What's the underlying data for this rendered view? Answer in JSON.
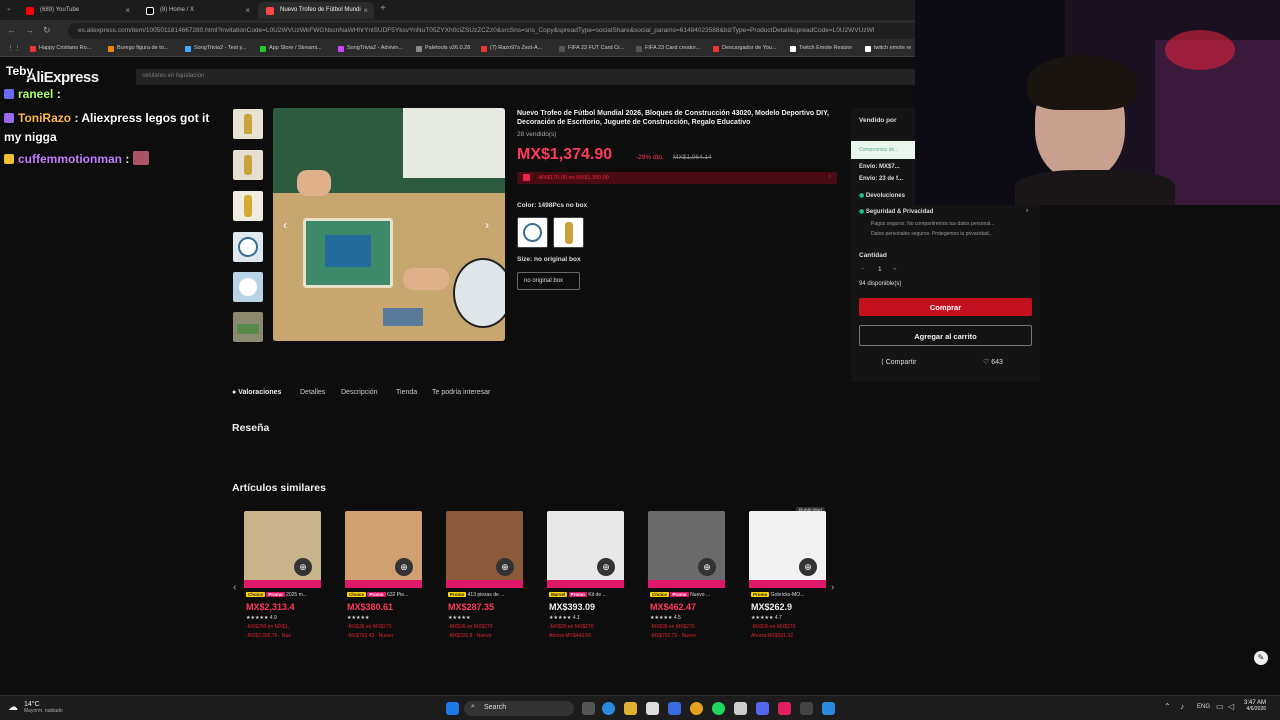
{
  "browser": {
    "tabs": [
      {
        "label": "(689) YouTube",
        "color": "#ff0000"
      },
      {
        "label": "(8) Home / X",
        "color": "#ffffff"
      },
      {
        "label": "Nuevo Trofeo de Fútbol Mundi",
        "color": "#ff4747"
      }
    ],
    "url": "es.aliexpress.com/item/1005011814667280.html?invitationCode=L0U2WVUzWkFWGNscnNaWHhrYnlSUDF5YksvYnNuT05ZYXh0clZSUzZCZz0&srcSns=sns_Copy&spreadType=socialShare&social_params=61484023588&bizType=ProductDetail&spreadCode=L0U2WVUzWl",
    "bookmarks": [
      "Happy Cristiano Ro...",
      "Burego figura de to...",
      "SongTrivia2 - Test y...",
      "App Store / Streami...",
      "SongTrivia2 - Advivin...",
      "Paletools v26.0.28",
      "(7) Razo97s Zest-A...",
      "FIFA 23 FUT Card Cr...",
      "FIFA 23 Card creator...",
      "Descargador de You...",
      "Twitch Emote Resizer",
      "twitch emote re"
    ]
  },
  "page": {
    "logo": "AliExpress",
    "search_placeholder": "celulares en liquidacion"
  },
  "chat": [
    {
      "user": "Teby",
      "text": ""
    },
    {
      "user": "raneel",
      "text": ":"
    },
    {
      "user": "ToniRazo",
      "text": ": Aliexpress legos got it my nigga"
    },
    {
      "user": "cuffemmotionman",
      "text": ":"
    }
  ],
  "product": {
    "title": "Nuevo Trofeo de Fútbol Mundial 2026, Bloques de Construcción 43020, Modelo Deportivo DIY, Decoración de Escritorio, Juguete de Construcción, Regalo Educativo",
    "sold": "28 vendido(s)",
    "price": "MX$1,374.90",
    "discount": "-29% dto.",
    "old_price": "MX$1,964.14",
    "coupon": "-MX$170.00 en MX$1,350.00",
    "color_label": "Color: 1498Pcs no box",
    "size_label": "Size: no original box",
    "size_option": "no original box"
  },
  "panel": {
    "sold_by": "Vendido por",
    "guarantee": "Compromiso de...",
    "shipping1": "Envío: MX$7...",
    "shipping2": "Envío: 23 de f...",
    "returns": "Devoluciones",
    "security": "Seguridad & Privacidad",
    "security_l1": "Pagos seguros: No compartiremos tus datos personal...",
    "security_l2": "Datos personales seguros: Protegemos tu privacidad...",
    "qty_label": "Cantidad",
    "qty_value": "1",
    "available": "94 disponible(s)",
    "buy": "Comprar",
    "cart": "Agregar al carrito",
    "share": "Compartir",
    "likes": "643"
  },
  "tabs": [
    "Valoraciones",
    "Detalles",
    "Descripción",
    "Tienda",
    "Te podría interesar"
  ],
  "sections": {
    "review": "Reseña",
    "similar": "Artículos similares"
  },
  "similar": [
    {
      "tag1": "Choice",
      "tag2": "Promo",
      "title": "2025 m...",
      "price": "MX$2,313.4",
      "rating": "4.9",
      "l1": "-MX$250 en MX$1,",
      "l2": "-MX$2,655.76 · Nue",
      "img": "#c8b48a",
      "price_red": true
    },
    {
      "tag1": "Choice",
      "tag2": "Promo",
      "title": "632 Pie...",
      "price": "MX$380.61",
      "rating": "",
      "l1": "-MX$36 en MX$270",
      "l2": "-MX$793.43 · Nuevo",
      "img": "#d0a070",
      "price_red": true
    },
    {
      "tag1": "Promo",
      "tag2": "",
      "title": "413 piezas de ...",
      "price": "MX$287.35",
      "rating": "",
      "l1": "-MX$36 en MX$270",
      "l2": "-MX$331.8 · Nuevo",
      "img": "#8a5a3a",
      "price_red": true
    },
    {
      "tag1": "Marvel",
      "tag2": "Promo",
      "title": "Kit de ...",
      "price": "MX$393.09",
      "rating": "4.1",
      "l1": "-MX$36 en MX$270",
      "l2": "Ahorra MX$443.66",
      "img": "#e8e8e8",
      "price_red": false
    },
    {
      "tag1": "Choice",
      "tag2": "Promo",
      "title": "Nuevo ...",
      "price": "MX$462.47",
      "rating": "4.5",
      "l1": "-MX$36 en MX$270",
      "l2": "-MX$792.73 · Nuevo",
      "img": "#6a6a6a",
      "price_red": true
    },
    {
      "tag1": "Promo",
      "tag2": "",
      "title": "Gobricks-MO...",
      "price": "MX$262.9",
      "rating": "4.7",
      "l1": "-MX$36 en MX$270",
      "l2": "Ahorra MX$301.32",
      "img": "#f2f2f2",
      "price_red": false
    }
  ],
  "ad_label": "Publicidad",
  "taskbar": {
    "weather_temp": "14°C",
    "weather_desc": "Mayorm. nublado",
    "search": "Search",
    "lang": "ENG",
    "time": "3:47 AM",
    "date": "4/6/2026"
  }
}
